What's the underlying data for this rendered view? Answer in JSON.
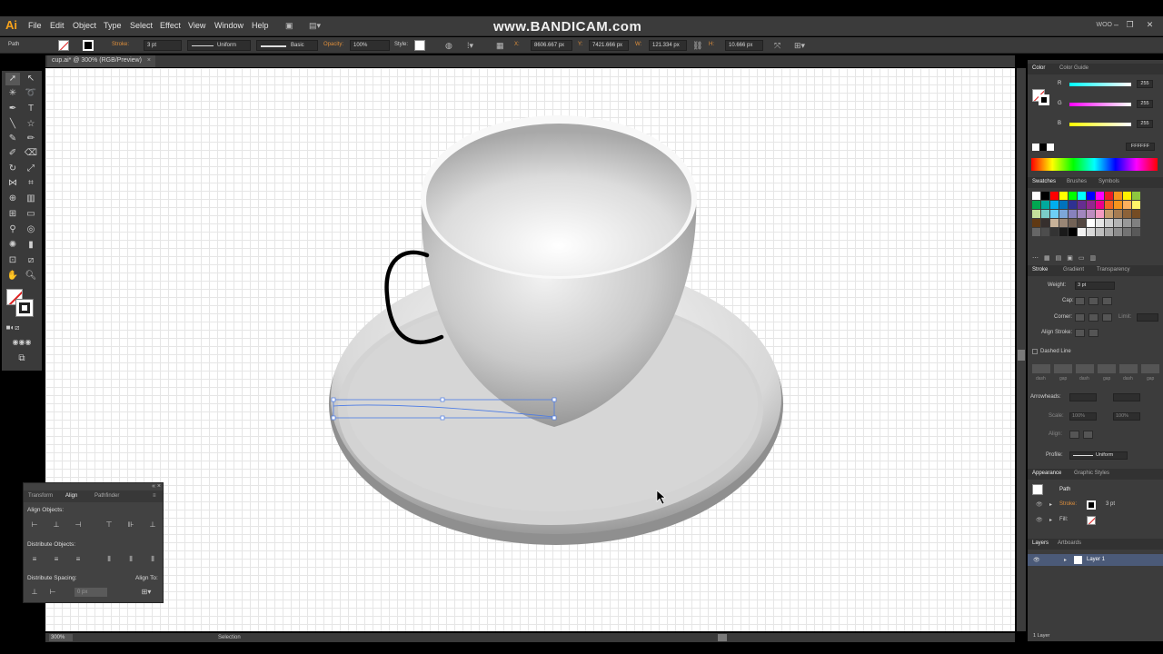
{
  "app": {
    "logo": "Ai",
    "menu": [
      "File",
      "Edit",
      "Object",
      "Type",
      "Select",
      "Effect",
      "View",
      "Window",
      "Help"
    ],
    "watermark": "www.BANDICAM.com",
    "workspace": "WOO",
    "window_buttons": [
      "–",
      "❐",
      "✕"
    ]
  },
  "control_bar": {
    "selection": "Path",
    "stroke_label": "Stroke:",
    "stroke_weight": "3 pt",
    "profile": "Uniform",
    "brush": "Basic",
    "opacity_label": "Opacity:",
    "opacity": "100%",
    "style_label": "Style:",
    "x_label": "X:",
    "x": "8606.667 px",
    "y_label": "Y:",
    "y": "7421.666 px",
    "w_label": "W:",
    "w": "121.334 px",
    "h_label": "H:",
    "h": "10.666 px"
  },
  "document": {
    "tab_title": "cup.ai* @ 300% (RGB/Preview)",
    "zoom": "300%",
    "status_tool": "Selection"
  },
  "align_panel": {
    "tabs": [
      "Transform",
      "Align",
      "Pathfinder"
    ],
    "align_objects": "Align Objects:",
    "distribute_objects": "Distribute Objects:",
    "distribute_spacing": "Distribute Spacing:",
    "align_to": "Align To:",
    "spacing_value": "0 px"
  },
  "color_panel": {
    "tabs": [
      "Color",
      "Color Guide"
    ],
    "channels": [
      {
        "label": "R",
        "value": "255",
        "color": "#52d8d8"
      },
      {
        "label": "G",
        "value": "255",
        "color": "#d83ad8"
      },
      {
        "label": "B",
        "value": "255",
        "color": "#d8d820"
      }
    ],
    "hex": "FFFFFF"
  },
  "swatches_panel": {
    "tabs": [
      "Swatches",
      "Brushes",
      "Symbols"
    ],
    "colors": [
      "#ffffff",
      "#000000",
      "#ff0000",
      "#ffff00",
      "#00ff00",
      "#00ffff",
      "#0000ff",
      "#ff00ff",
      "#ed1c24",
      "#f7941d",
      "#fff200",
      "#8dc63f",
      "#00a651",
      "#00a99d",
      "#00aeef",
      "#0072bc",
      "#2e3192",
      "#662d91",
      "#92278f",
      "#ec008c",
      "#f26522",
      "#f7941d",
      "#fbaf5d",
      "#fff568",
      "#c4df9b",
      "#7accc8",
      "#6dcff6",
      "#7da7d9",
      "#8781bd",
      "#a186be",
      "#bd8cbf",
      "#f49ac1",
      "#c69c6d",
      "#a67c52",
      "#8c6239",
      "#754c24",
      "#603913",
      "#362f2d",
      "#c7b299",
      "#998675",
      "#736357",
      "#534741",
      "#ffffff",
      "#e6e6e6",
      "#cccccc",
      "#b3b3b3",
      "#999999",
      "#808080",
      "#666666",
      "#4d4d4d",
      "#333333",
      "#1a1a1a",
      "#000000",
      "#f2f2f2",
      "#d9d9d9",
      "#bfbfbf",
      "#a6a6a6",
      "#8c8c8c",
      "#737373",
      "#595959"
    ]
  },
  "stroke_panel": {
    "tabs": [
      "Stroke",
      "Gradient",
      "Transparency"
    ],
    "weight_label": "Weight:",
    "weight": "3 pt",
    "cap_label": "Cap:",
    "corner_label": "Corner:",
    "limit_label": "Limit:",
    "align_stroke_label": "Align Stroke:",
    "dashed_line": "Dashed Line",
    "dash_labels": [
      "dash",
      "gap",
      "dash",
      "gap",
      "dash",
      "gap"
    ],
    "arrowheads_label": "Arrowheads:",
    "scale_label": "Scale:",
    "scale_values": [
      "100%",
      "100%"
    ],
    "align_label": "Align:",
    "profile_label": "Profile:",
    "profile": "Uniform"
  },
  "appearance_panel": {
    "tabs": [
      "Appearance",
      "Graphic Styles"
    ],
    "object": "Path",
    "stroke_label": "Stroke:",
    "stroke_value": "3 pt",
    "fill_label": "Fill:"
  },
  "layers_panel": {
    "tabs": [
      "Layers",
      "Artboards"
    ],
    "layer_name": "Layer 1",
    "footer": "1 Layer"
  }
}
